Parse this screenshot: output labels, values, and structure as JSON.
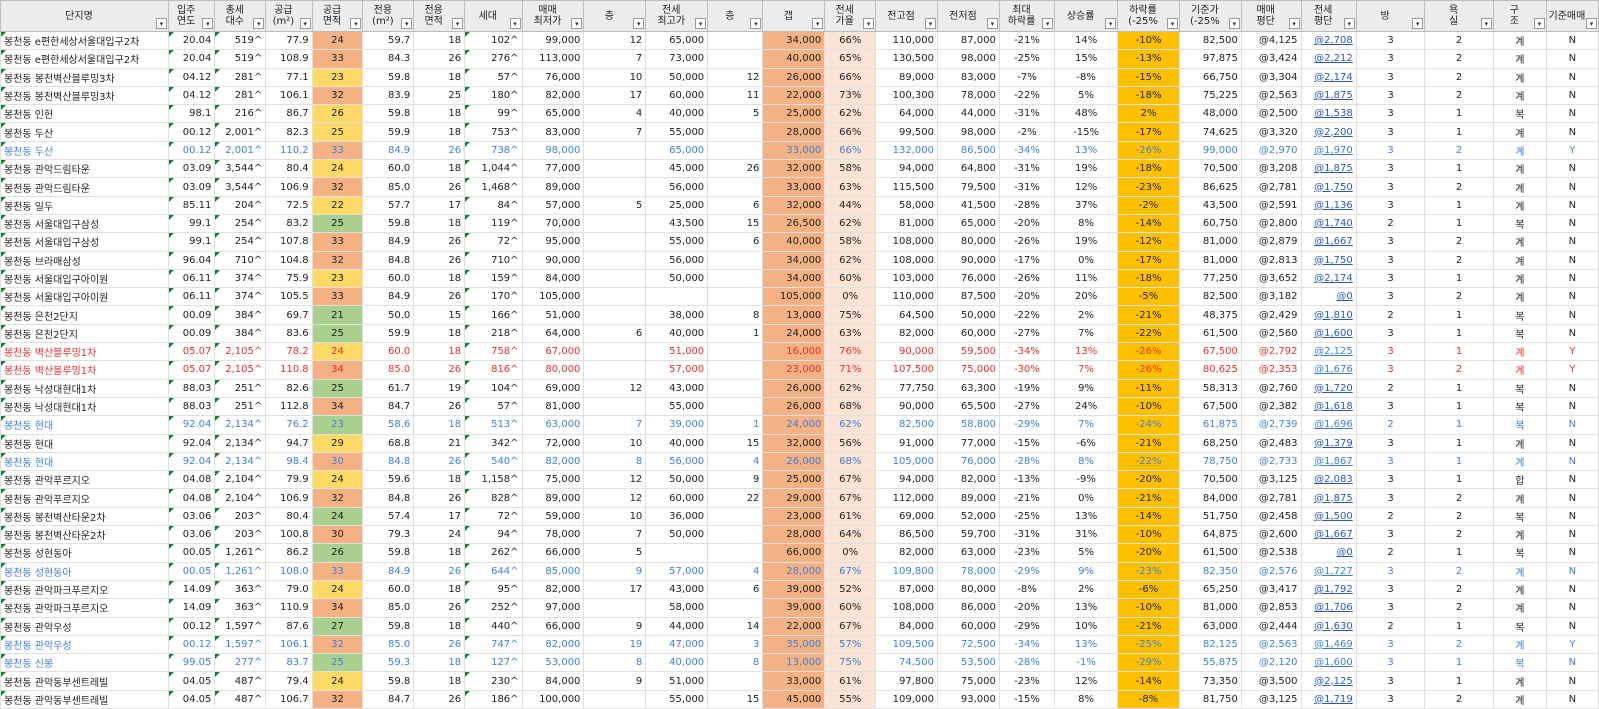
{
  "headers": [
    "단지명",
    "입주\n연도",
    "총세\n대수",
    "공급\n(m²)",
    "공급\n면적",
    "전용\n(m²)",
    "전용\n면적",
    "세대",
    "매매\n최저가",
    "층",
    "전세\n최고가",
    "층",
    "갭",
    "전세\n가율",
    "전고점",
    "전저점",
    "최대\n하락률",
    "상승률",
    "하락률\n(-25%",
    "기준가\n(-25%",
    "매매\n평단",
    "전세\n평단",
    "방",
    "욕\n실",
    "구\n조",
    "기준매매"
  ],
  "colors": {
    "green": "#a9d08e",
    "yellow": "#ffd966",
    "orange": "#f4b183",
    "drop": "#ffc000",
    "pink": "#fbe3d6",
    "blue_text": "#3f7fd6",
    "red_text": "#e0312f"
  },
  "rows": [
    {
      "s": "",
      "a": "orange",
      "c": [
        "봉천동 e편한세상서울대입구2차",
        "20.04",
        "519^",
        "77.9",
        "24",
        "59.7",
        "18",
        "102^",
        "99,000",
        "12",
        "65,000",
        "",
        "34,000",
        "66%",
        "110,000",
        "87,000",
        "-21%",
        "14%",
        "-10%",
        "82,500",
        "@4,125",
        "@2,708",
        "3",
        "2",
        "계",
        "N"
      ]
    },
    {
      "s": "",
      "a": "orange",
      "c": [
        "봉천동 e편한세상서울대입구2차",
        "20.04",
        "519^",
        "108.9",
        "33",
        "84.3",
        "26",
        "276^",
        "113,000",
        "7",
        "73,000",
        "",
        "40,000",
        "65%",
        "130,500",
        "98,000",
        "-25%",
        "15%",
        "-13%",
        "97,875",
        "@3,424",
        "@2,212",
        "3",
        "2",
        "계",
        "N"
      ]
    },
    {
      "s": "",
      "a": "yellow",
      "c": [
        "봉천동 봉천벽산블루밍3차",
        "04.12",
        "281^",
        "77.1",
        "23",
        "59.8",
        "18",
        "57^",
        "76,000",
        "10",
        "50,000",
        "12",
        "26,000",
        "66%",
        "89,000",
        "83,000",
        "-7%",
        "-8%",
        "-15%",
        "66,750",
        "@3,304",
        "@2,174",
        "3",
        "2",
        "계",
        "N"
      ]
    },
    {
      "s": "",
      "a": "orange",
      "c": [
        "봉천동 봉천벽산블루밍3차",
        "04.12",
        "281^",
        "106.1",
        "32",
        "83.9",
        "25",
        "180^",
        "82,000",
        "17",
        "60,000",
        "11",
        "22,000",
        "73%",
        "100,300",
        "78,000",
        "-22%",
        "5%",
        "-18%",
        "75,225",
        "@2,563",
        "@1,875",
        "3",
        "2",
        "계",
        "N"
      ]
    },
    {
      "s": "",
      "a": "yellow",
      "c": [
        "봉천동 인헌",
        "98.1",
        "216^",
        "86.7",
        "26",
        "59.8",
        "18",
        "99^",
        "65,000",
        "4",
        "40,000",
        "5",
        "25,000",
        "62%",
        "64,000",
        "44,000",
        "-31%",
        "48%",
        "2%",
        "48,000",
        "@2,500",
        "@1,538",
        "3",
        "1",
        "복",
        "N"
      ]
    },
    {
      "s": "",
      "a": "yellow",
      "c": [
        "봉천동 두산",
        "00.12",
        "2,001^",
        "82.3",
        "25",
        "59.9",
        "18",
        "753^",
        "83,000",
        "7",
        "55,000",
        "",
        "28,000",
        "66%",
        "99,500",
        "98,000",
        "-2%",
        "-15%",
        "-17%",
        "74,625",
        "@3,320",
        "@2,200",
        "3",
        "1",
        "계",
        "N"
      ]
    },
    {
      "s": "blue",
      "a": "orange",
      "c": [
        "봉천동 두산",
        "00.12",
        "2,001^",
        "110.2",
        "33",
        "84.9",
        "26",
        "738^",
        "98,000",
        "",
        "65,000",
        "",
        "33,000",
        "66%",
        "132,000",
        "86,500",
        "-34%",
        "13%",
        "-26%",
        "99,000",
        "@2,970",
        "@1,970",
        "3",
        "2",
        "계",
        "Y"
      ]
    },
    {
      "s": "",
      "a": "yellow",
      "c": [
        "봉천동 관악드림타운",
        "03.09",
        "3,544^",
        "80.4",
        "24",
        "60.0",
        "18",
        "1,044^",
        "77,000",
        "",
        "45,000",
        "26",
        "32,000",
        "58%",
        "94,000",
        "64,800",
        "-31%",
        "19%",
        "-18%",
        "70,500",
        "@3,208",
        "@1,875",
        "3",
        "1",
        "계",
        "N"
      ]
    },
    {
      "s": "",
      "a": "orange",
      "c": [
        "봉천동 관악드림타운",
        "03.09",
        "3,544^",
        "106.9",
        "32",
        "85.0",
        "26",
        "1,468^",
        "89,000",
        "",
        "56,000",
        "",
        "33,000",
        "63%",
        "115,500",
        "79,500",
        "-31%",
        "12%",
        "-23%",
        "86,625",
        "@2,781",
        "@1,750",
        "3",
        "2",
        "계",
        "N"
      ]
    },
    {
      "s": "",
      "a": "yellow",
      "c": [
        "봉천동 일두",
        "85.11",
        "204^",
        "72.5",
        "22",
        "57.7",
        "17",
        "84^",
        "57,000",
        "5",
        "25,000",
        "6",
        "32,000",
        "44%",
        "58,000",
        "41,500",
        "-28%",
        "37%",
        "-2%",
        "43,500",
        "@2,591",
        "@1,136",
        "3",
        "1",
        "계",
        "N"
      ]
    },
    {
      "s": "",
      "a": "green",
      "c": [
        "봉천동 서울대입구삼성",
        "99.1",
        "254^",
        "83.2",
        "25",
        "59.8",
        "18",
        "119^",
        "70,000",
        "",
        "43,500",
        "15",
        "26,500",
        "62%",
        "81,000",
        "65,000",
        "-20%",
        "8%",
        "-14%",
        "60,750",
        "@2,800",
        "@1,740",
        "2",
        "1",
        "복",
        "N"
      ]
    },
    {
      "s": "",
      "a": "orange",
      "c": [
        "봉천동 서울대입구삼성",
        "99.1",
        "254^",
        "107.8",
        "33",
        "84.9",
        "26",
        "72^",
        "95,000",
        "",
        "55,000",
        "6",
        "40,000",
        "58%",
        "108,000",
        "80,000",
        "-26%",
        "19%",
        "-12%",
        "81,000",
        "@2,879",
        "@1,667",
        "3",
        "2",
        "계",
        "N"
      ]
    },
    {
      "s": "",
      "a": "orange",
      "c": [
        "봉천동 브라매삼성",
        "96.04",
        "710^",
        "104.8",
        "32",
        "84.8",
        "26",
        "710^",
        "90,000",
        "",
        "56,000",
        "",
        "34,000",
        "62%",
        "108,000",
        "90,000",
        "-17%",
        "0%",
        "-17%",
        "81,000",
        "@2,813",
        "@1,750",
        "3",
        "2",
        "계",
        "N"
      ]
    },
    {
      "s": "",
      "a": "yellow",
      "c": [
        "봉천동 서울대입구아이원",
        "06.11",
        "374^",
        "75.9",
        "23",
        "60.0",
        "18",
        "159^",
        "84,000",
        "",
        "50,000",
        "",
        "34,000",
        "60%",
        "103,000",
        "76,000",
        "-26%",
        "11%",
        "-18%",
        "77,250",
        "@3,652",
        "@2,174",
        "3",
        "1",
        "계",
        "N"
      ]
    },
    {
      "s": "",
      "a": "orange",
      "c": [
        "봉천동 서울대입구아이원",
        "06.11",
        "374^",
        "105.5",
        "33",
        "84.9",
        "26",
        "170^",
        "105,000",
        "",
        "",
        "",
        "105,000",
        "0%",
        "110,000",
        "87,500",
        "-20%",
        "20%",
        "-5%",
        "82,500",
        "@3,182",
        "@0",
        "3",
        "2",
        "계",
        "N"
      ]
    },
    {
      "s": "",
      "a": "green",
      "c": [
        "봉천동 은천2단지",
        "00.09",
        "384^",
        "69.7",
        "21",
        "50.0",
        "15",
        "166^",
        "51,000",
        "",
        "38,000",
        "8",
        "13,000",
        "75%",
        "64,500",
        "50,000",
        "-22%",
        "2%",
        "-21%",
        "48,375",
        "@2,429",
        "@1,810",
        "2",
        "1",
        "복",
        "N"
      ]
    },
    {
      "s": "",
      "a": "green",
      "c": [
        "봉천동 은천2단지",
        "00.09",
        "384^",
        "83.6",
        "25",
        "59.9",
        "18",
        "218^",
        "64,000",
        "6",
        "40,000",
        "1",
        "24,000",
        "63%",
        "82,000",
        "60,000",
        "-27%",
        "7%",
        "-22%",
        "61,500",
        "@2,560",
        "@1,600",
        "3",
        "1",
        "복",
        "N"
      ]
    },
    {
      "s": "red",
      "a": "yellow",
      "c": [
        "봉천동 벽산블루밍1차",
        "05.07",
        "2,105^",
        "78.2",
        "24",
        "60.0",
        "18",
        "758^",
        "67,000",
        "",
        "51,000",
        "",
        "16,000",
        "76%",
        "90,000",
        "59,500",
        "-34%",
        "13%",
        "-26%",
        "67,500",
        "@2,792",
        "@2,125",
        "3",
        "1",
        "계",
        "Y"
      ]
    },
    {
      "s": "red",
      "a": "orange",
      "c": [
        "봉천동 벽산블루밍1차",
        "05.07",
        "2,105^",
        "110.8",
        "34",
        "85.0",
        "26",
        "816^",
        "80,000",
        "",
        "57,000",
        "",
        "23,000",
        "71%",
        "107,500",
        "75,000",
        "-30%",
        "7%",
        "-26%",
        "80,625",
        "@2,353",
        "@1,676",
        "3",
        "2",
        "계",
        "Y"
      ]
    },
    {
      "s": "",
      "a": "green",
      "c": [
        "봉천동 낙성대현대1차",
        "88.03",
        "251^",
        "82.6",
        "25",
        "61.7",
        "19",
        "104^",
        "69,000",
        "12",
        "43,000",
        "",
        "26,000",
        "62%",
        "77,750",
        "63,300",
        "-19%",
        "9%",
        "-11%",
        "58,313",
        "@2,760",
        "@1,720",
        "2",
        "1",
        "복",
        "N"
      ]
    },
    {
      "s": "",
      "a": "orange",
      "c": [
        "봉천동 낙성대현대1차",
        "88.03",
        "251^",
        "112.8",
        "34",
        "84.7",
        "26",
        "57^",
        "81,000",
        "",
        "55,000",
        "",
        "26,000",
        "68%",
        "90,000",
        "65,500",
        "-27%",
        "24%",
        "-10%",
        "67,500",
        "@2,382",
        "@1,618",
        "3",
        "1",
        "복",
        "N"
      ]
    },
    {
      "s": "blue",
      "a": "green",
      "c": [
        "봉천동 현대",
        "92.04",
        "2,134^",
        "76.2",
        "23",
        "58.6",
        "18",
        "513^",
        "63,000",
        "7",
        "39,000",
        "1",
        "24,000",
        "62%",
        "82,500",
        "58,800",
        "-29%",
        "7%",
        "-24%",
        "61,875",
        "@2,739",
        "@1,696",
        "2",
        "1",
        "복",
        "N"
      ]
    },
    {
      "s": "",
      "a": "yellow",
      "c": [
        "봉천동 현대",
        "92.04",
        "2,134^",
        "94.7",
        "29",
        "68.8",
        "21",
        "342^",
        "72,000",
        "10",
        "40,000",
        "15",
        "32,000",
        "56%",
        "91,000",
        "77,000",
        "-15%",
        "-6%",
        "-21%",
        "68,250",
        "@2,483",
        "@1,379",
        "3",
        "1",
        "계",
        "N"
      ]
    },
    {
      "s": "blue",
      "a": "orange",
      "c": [
        "봉천동 현대",
        "92.04",
        "2,134^",
        "98.4",
        "30",
        "84.8",
        "26",
        "540^",
        "82,000",
        "8",
        "56,000",
        "4",
        "26,000",
        "68%",
        "105,000",
        "76,000",
        "-28%",
        "8%",
        "-22%",
        "78,750",
        "@2,733",
        "@1,867",
        "3",
        "1",
        "계",
        "N"
      ]
    },
    {
      "s": "",
      "a": "yellow",
      "c": [
        "봉천동 관악푸르지오",
        "04.08",
        "2,104^",
        "79.9",
        "24",
        "59.6",
        "18",
        "1,158^",
        "75,000",
        "12",
        "50,000",
        "9",
        "25,000",
        "67%",
        "94,000",
        "82,000",
        "-13%",
        "-9%",
        "-20%",
        "70,500",
        "@3,125",
        "@2,083",
        "3",
        "1",
        "합",
        "N"
      ]
    },
    {
      "s": "",
      "a": "orange",
      "c": [
        "봉천동 관악푸르지오",
        "04.08",
        "2,104^",
        "106.9",
        "32",
        "84.8",
        "26",
        "828^",
        "89,000",
        "12",
        "60,000",
        "22",
        "29,000",
        "67%",
        "112,000",
        "89,000",
        "-21%",
        "0%",
        "-21%",
        "84,000",
        "@2,781",
        "@1,875",
        "3",
        "2",
        "계",
        "N"
      ]
    },
    {
      "s": "",
      "a": "green",
      "c": [
        "봉천동 봉천벽산타운2차",
        "03.06",
        "203^",
        "80.4",
        "24",
        "57.4",
        "17",
        "72^",
        "59,000",
        "10",
        "36,000",
        "",
        "23,000",
        "61%",
        "69,000",
        "52,000",
        "-25%",
        "13%",
        "-14%",
        "51,750",
        "@2,458",
        "@1,500",
        "2",
        "2",
        "복",
        "N"
      ]
    },
    {
      "s": "",
      "a": "orange",
      "c": [
        "봉천동 봉천벽산타운2차",
        "03.06",
        "203^",
        "100.8",
        "30",
        "79.3",
        "24",
        "94^",
        "78,000",
        "7",
        "50,000",
        "",
        "28,000",
        "64%",
        "86,500",
        "59,700",
        "-31%",
        "31%",
        "-10%",
        "64,875",
        "@2,600",
        "@1,667",
        "3",
        "2",
        "계",
        "N"
      ]
    },
    {
      "s": "",
      "a": "green",
      "c": [
        "봉천동 성현동아",
        "00.05",
        "1,261^",
        "86.2",
        "26",
        "59.8",
        "18",
        "262^",
        "66,000",
        "5",
        "",
        "",
        "66,000",
        "0%",
        "82,000",
        "63,000",
        "-23%",
        "5%",
        "-20%",
        "61,500",
        "@2,538",
        "@0",
        "2",
        "1",
        "복",
        "N"
      ]
    },
    {
      "s": "blue",
      "a": "orange",
      "c": [
        "봉천동 성현동아",
        "00.05",
        "1,261^",
        "108.0",
        "33",
        "84.9",
        "26",
        "644^",
        "85,000",
        "9",
        "57,000",
        "4",
        "28,000",
        "67%",
        "109,800",
        "78,000",
        "-29%",
        "9%",
        "-23%",
        "82,350",
        "@2,576",
        "@1,727",
        "3",
        "2",
        "계",
        "N"
      ]
    },
    {
      "s": "",
      "a": "yellow",
      "c": [
        "봉천동 관악파크푸르지오",
        "14.09",
        "363^",
        "79.0",
        "24",
        "60.0",
        "18",
        "95^",
        "82,000",
        "17",
        "43,000",
        "6",
        "39,000",
        "52%",
        "87,000",
        "80,000",
        "-8%",
        "2%",
        "-6%",
        "65,250",
        "@3,417",
        "@1,792",
        "3",
        "2",
        "계",
        "N"
      ]
    },
    {
      "s": "",
      "a": "orange",
      "c": [
        "봉천동 관악파크푸르지오",
        "14.09",
        "363^",
        "110.9",
        "34",
        "85.0",
        "26",
        "252^",
        "97,000",
        "",
        "58,000",
        "",
        "39,000",
        "60%",
        "108,000",
        "86,000",
        "-20%",
        "13%",
        "-10%",
        "81,000",
        "@2,853",
        "@1,706",
        "3",
        "2",
        "계",
        "N"
      ]
    },
    {
      "s": "",
      "a": "green",
      "c": [
        "봉천동 관악우성",
        "00.12",
        "1,597^",
        "87.6",
        "27",
        "59.8",
        "18",
        "440^",
        "66,000",
        "9",
        "44,000",
        "14",
        "22,000",
        "67%",
        "84,000",
        "60,000",
        "-29%",
        "10%",
        "-21%",
        "63,000",
        "@2,444",
        "@1,630",
        "2",
        "1",
        "복",
        "N"
      ]
    },
    {
      "s": "blue",
      "a": "orange",
      "c": [
        "봉천동 관악우성",
        "00.12",
        "1,597^",
        "106.1",
        "32",
        "85.0",
        "26",
        "747^",
        "82,000",
        "19",
        "47,000",
        "3",
        "35,000",
        "57%",
        "109,500",
        "72,500",
        "-34%",
        "13%",
        "-25%",
        "82,125",
        "@2,563",
        "@1,469",
        "3",
        "2",
        "계",
        "Y"
      ]
    },
    {
      "s": "blue",
      "a": "green",
      "c": [
        "봉천동 신봉",
        "99.05",
        "277^",
        "83.7",
        "25",
        "59.3",
        "18",
        "127^",
        "53,000",
        "8",
        "40,000",
        "8",
        "13,000",
        "75%",
        "74,500",
        "53,500",
        "-28%",
        "-1%",
        "-29%",
        "55,875",
        "@2,120",
        "@1,600",
        "3",
        "1",
        "복",
        "N"
      ]
    },
    {
      "s": "",
      "a": "yellow",
      "c": [
        "봉천동 관악동부센트레빌",
        "04.05",
        "487^",
        "79.4",
        "24",
        "59.8",
        "18",
        "230^",
        "84,000",
        "9",
        "51,000",
        "",
        "33,000",
        "61%",
        "97,800",
        "75,000",
        "-23%",
        "12%",
        "-14%",
        "73,350",
        "@3,500",
        "@2,125",
        "3",
        "1",
        "계",
        "N"
      ]
    },
    {
      "s": "",
      "a": "orange",
      "c": [
        "봉천동 관악동부센트레빌",
        "04.05",
        "487^",
        "106.7",
        "32",
        "84.7",
        "26",
        "186^",
        "100,000",
        "",
        "55,000",
        "15",
        "45,000",
        "55%",
        "109,000",
        "93,000",
        "-15%",
        "8%",
        "-8%",
        "81,750",
        "@3,125",
        "@1,719",
        "3",
        "2",
        "계",
        "N"
      ]
    }
  ]
}
